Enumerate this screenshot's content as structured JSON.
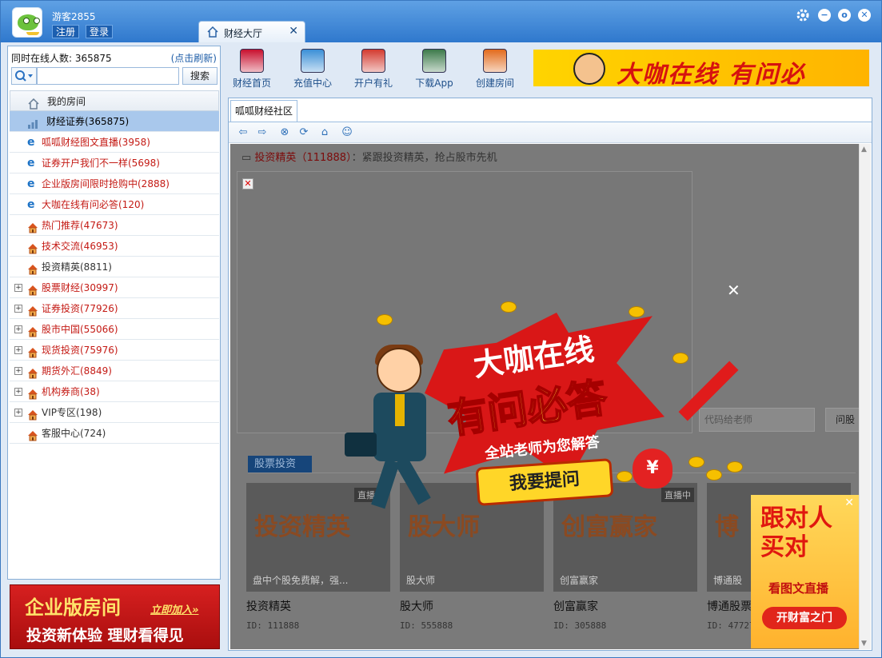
{
  "titlebar": {
    "username": "游客2855",
    "register_label": "注册",
    "login_label": "登录",
    "tab_label": "财经大厅",
    "tab_close": "✕"
  },
  "window_buttons": {
    "settings": "gear-icon",
    "minimize": "−",
    "restore": "o",
    "close": "✕"
  },
  "left": {
    "online_label": "同时在线人数: 365875",
    "refresh_label": "(点击刷新)",
    "search_placeholder": "",
    "search_button": "搜索",
    "tree": [
      {
        "label": "我的房间",
        "kind": "head",
        "icon": "home-icon"
      },
      {
        "label": "财经证券(365875)",
        "kind": "selected",
        "icon": "chart-icon"
      },
      {
        "label": "呱呱财经图文直播(3958)",
        "kind": "ie",
        "color": "red"
      },
      {
        "label": "证券开户我们不一样(5698)",
        "kind": "ie",
        "color": "red"
      },
      {
        "label": "企业版房间限时抢购中(2888)",
        "kind": "ie",
        "color": "red"
      },
      {
        "label": "大咖在线有问必答(120)",
        "kind": "ie",
        "color": "red"
      },
      {
        "label": "热门推荐(47673)",
        "kind": "house",
        "color": "red"
      },
      {
        "label": "技术交流(46953)",
        "kind": "house",
        "color": "red"
      },
      {
        "label": "投资精英(8811)",
        "kind": "house",
        "color": "gray"
      },
      {
        "label": "股票财经(30997)",
        "kind": "group",
        "color": "red"
      },
      {
        "label": "证券投资(77926)",
        "kind": "group",
        "color": "red"
      },
      {
        "label": "股市中国(55066)",
        "kind": "group",
        "color": "red"
      },
      {
        "label": "现货投资(75976)",
        "kind": "group",
        "color": "red"
      },
      {
        "label": "期货外汇(8849)",
        "kind": "group",
        "color": "red"
      },
      {
        "label": "机构券商(38)",
        "kind": "group",
        "color": "red"
      },
      {
        "label": "VIP专区(198)",
        "kind": "group",
        "color": "gray"
      },
      {
        "label": "客服中心(724)",
        "kind": "house",
        "color": "gray"
      }
    ],
    "ad": {
      "line1": "企业版房间",
      "line1_link": "立即加入»",
      "line2": "投资新体验 理财看得见"
    }
  },
  "toolbar": {
    "items": [
      {
        "label": "财经首页",
        "icon": "finance-home-icon",
        "color": "#c8102e"
      },
      {
        "label": "充值中心",
        "icon": "recharge-icon",
        "color": "#3a8fd6"
      },
      {
        "label": "开户有礼",
        "icon": "gift-account-icon",
        "color": "#d33a2f"
      },
      {
        "label": "下载App",
        "icon": "download-app-icon",
        "color": "#3c7a4a"
      },
      {
        "label": "创建房间",
        "icon": "create-room-icon",
        "color": "#e26a1c"
      }
    ],
    "banner_text": "大咖在线 有问必"
  },
  "frame": {
    "tab_label": "呱呱财经社区",
    "nav_icons": [
      "back-arrow-icon",
      "forward-arrow-icon",
      "stop-icon",
      "refresh-icon",
      "home-icon",
      "chat-icon"
    ],
    "room_title": "投资精英",
    "room_id": "（111888）",
    "room_slogan": "：紧跟投资精英，抢占股市先机",
    "ask_placeholder": "代码给老师",
    "ask_button": "问股",
    "section_title": "股票投资",
    "cards": [
      {
        "name": "投资精英",
        "id": "ID: 111888",
        "live": "直播中",
        "caption": "盘中个股免费解，强...",
        "big": "投资精英"
      },
      {
        "name": "股大师",
        "id": "ID: 555888",
        "live": "",
        "caption": "股大师",
        "big": "股大师"
      },
      {
        "name": "创富赢家",
        "id": "ID: 305888",
        "live": "直播中",
        "caption": "创富赢家",
        "big": "创富赢家"
      },
      {
        "name": "博通股票",
        "id": "ID: 47727",
        "live": "",
        "caption": "博通股",
        "big": "博"
      }
    ]
  },
  "overlay": {
    "close": "✕",
    "line1": "大咖在线",
    "line2": "有问必答",
    "line3": "全站老师为您解答",
    "button": "我要提问",
    "bag_symbol": "¥"
  },
  "ad_right": {
    "close": "✕",
    "title": "跟对人 买对",
    "sub": "看图文直播",
    "button": "开财富之门"
  }
}
